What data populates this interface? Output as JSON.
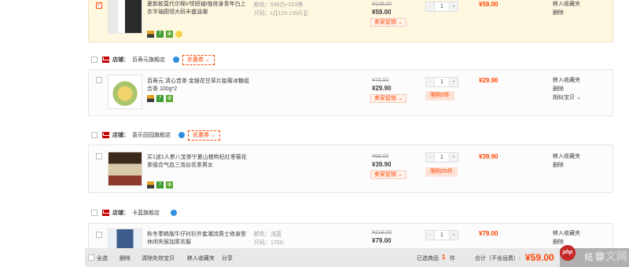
{
  "items": [
    {
      "title": "夏新款莫代尔棉V领短袖t恤修身青年白上衣半袖圆领大码丰盛油潮",
      "spec_color": "颜色：535白+523黑",
      "spec_size": "尺码：L[【120-135斤】]",
      "old_price": "¥128.00",
      "price": "¥59.00",
      "promo": "卖家促销 ⌄",
      "qty": "1",
      "subtotal": "¥59.00",
      "op1": "移入收藏夹",
      "op2": "删除"
    },
    {
      "title": "百寿元 清心苦茶 金银花甘草片胎菊冰糖组合茶 100g*2",
      "old_price": "¥75.00",
      "price": "¥29.90",
      "promo": "卖家促销 ⌄",
      "qty": "1",
      "limit": "限购3件",
      "subtotal": "¥29.90",
      "op1": "移入收藏夹",
      "op2": "删除",
      "op3": "相似宝贝 ⌄"
    },
    {
      "title": "买1送1人参八宝茶宁夏山楂枸杞红枣菊花茶组合气血三泡台花茶男女",
      "old_price": "¥69.00",
      "price": "¥39.90",
      "promo": "卖家促销 ⌄",
      "qty": "1",
      "limit": "限购25件",
      "subtotal": "¥39.90",
      "op1": "移入收藏夹",
      "op2": "删除"
    },
    {
      "title": "秋冬季韩版牛仔衬衫外套潮流男士修身型休闲夹层加厚衣服",
      "spec_color": "颜色：浅蓝",
      "spec_size": "尺码：170/L",
      "old_price": "¥219.00",
      "price": "¥79.00",
      "qty": "1",
      "subtotal": "¥79.00",
      "op1": "移入收藏夹",
      "op2": "删除"
    }
  ],
  "shops": [
    {
      "label": "店铺：",
      "name": "百寿元旗舰店",
      "coupon": "优惠券 ⌄"
    },
    {
      "label": "店铺：",
      "name": "喜乐田园旗舰店",
      "coupon": "优惠券 ⌄"
    },
    {
      "label": "店铺：",
      "name": "卡蓝旗舰店"
    }
  ],
  "footer": {
    "select_all": "全选",
    "delete": "删除",
    "clear_invalid": "清除失效宝贝",
    "move_fav": "移入收藏夹",
    "share": "分享",
    "selected_label": "已选商品",
    "selected_count": "1",
    "selected_unit": "件",
    "total_label": "合计（不含运费）:",
    "total": "¥59.00",
    "settle": "结 算"
  },
  "watermark": "中文网",
  "watermark_logo": "php"
}
